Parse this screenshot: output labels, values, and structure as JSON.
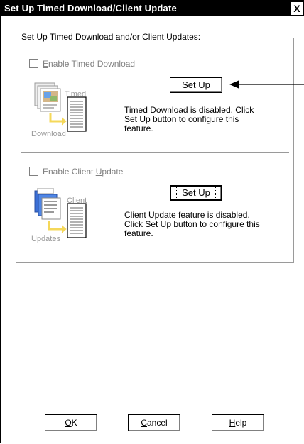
{
  "window": {
    "title": "Set Up Timed Download/Client Update",
    "close_glyph": "X"
  },
  "group": {
    "title": "Set Up Timed Download and/or Client Updates:"
  },
  "timed_download": {
    "checkbox_label_prefix": "E",
    "checkbox_label_rest": "nable Timed Download",
    "checked": false,
    "enabled": false,
    "illustration_top_label": "Timed",
    "illustration_bottom_label": "Download",
    "setup_button": "Set Up",
    "status_line1": "Timed Download is disabled.  Click",
    "status_line2": "Set Up button to configure this",
    "status_line3": "feature."
  },
  "client_update": {
    "checkbox_label_before": "Enable Client ",
    "checkbox_label_accel": "U",
    "checkbox_label_after": "pdate",
    "checked": false,
    "enabled": false,
    "illustration_top_label": "Client",
    "illustration_bottom_label": "Updates",
    "setup_button": "Set Up",
    "status_line1": "Client Update feature is disabled.",
    "status_line2": "Click Set Up button to configure this",
    "status_line3": "feature."
  },
  "footer": {
    "ok_accel": "O",
    "ok_rest": "K",
    "cancel_accel": "C",
    "cancel_rest": "ancel",
    "help_accel": "H",
    "help_rest": "elp"
  },
  "icons": {
    "close": "close-icon",
    "documents": "documents-icon",
    "server": "server-icon",
    "arrow": "callout-arrow-icon"
  },
  "colors": {
    "titlebar": "#000000",
    "disabled_text": "#808080",
    "icon_blue": "#3b6fd6",
    "icon_yellow": "#f5d85a"
  }
}
